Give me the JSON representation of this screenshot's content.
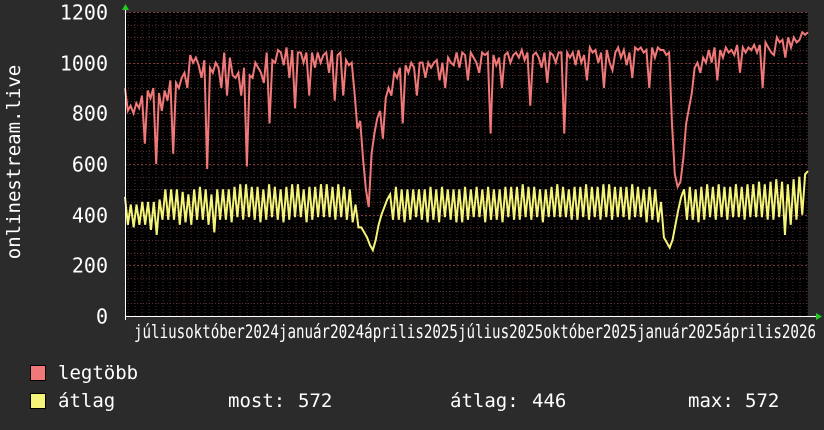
{
  "colors": {
    "background": "#2b2b2b",
    "plot_background": "#000000",
    "grid_major": "#7a3a3a",
    "grid_minor": "#553030",
    "axis": "#ffffff",
    "arrow": "#22cc22",
    "series_max": "#f07878",
    "series_avg": "#f4f47a"
  },
  "legend": {
    "max_label": "legtöbb",
    "avg_label": "átlag",
    "stats": {
      "now_label": "most:",
      "now_value": "572",
      "avg_label": "átlag:",
      "avg_value": "446",
      "max_label": "max:",
      "max_value": "572"
    }
  },
  "chart_data": {
    "type": "line",
    "ylabel": "onlinestream.live",
    "ylim": [
      0,
      1200
    ],
    "yticks": [
      0,
      200,
      400,
      600,
      800,
      1000,
      1200
    ],
    "grid": true,
    "x_labels": [
      "július",
      "október",
      "2024",
      "január",
      "április",
      "2025",
      "július",
      "október",
      "2025",
      "január",
      "április",
      "2026"
    ],
    "x_label_text": "júliusoktóber2024január2024április2025július2025október2025január2025április2026",
    "series": [
      {
        "name": "legtöbb",
        "color": "#f07878",
        "values": [
          900,
          810,
          830,
          800,
          840,
          820,
          870,
          680,
          890,
          860,
          900,
          600,
          880,
          810,
          890,
          850,
          930,
          640,
          920,
          900,
          940,
          960,
          900,
          1030,
          1000,
          1020,
          990,
          940,
          1010,
          580,
          980,
          960,
          1000,
          980,
          900,
          1040,
          870,
          1020,
          950,
          940,
          960,
          870,
          980,
          590,
          950,
          940,
          1000,
          980,
          960,
          920,
          1040,
          760,
          1010,
          1000,
          1050,
          1040,
          990,
          1060,
          940,
          1050,
          820,
          1040,
          1040,
          1000,
          1040,
          870,
          1040,
          980,
          1040,
          1000,
          1030,
          1040,
          960,
          1050,
          850,
          1030,
          1040,
          870,
          1010,
          990,
          1000,
          880,
          740,
          770,
          620,
          500,
          430,
          640,
          720,
          780,
          810,
          700,
          860,
          900,
          870,
          960,
          940,
          980,
          760,
          990,
          960,
          1000,
          980,
          870,
          1000,
          1000,
          940,
          1000,
          980,
          1000,
          1010,
          930,
          1000,
          900,
          1020,
          1000,
          990,
          1040,
          980,
          1040,
          1030,
          930,
          1040,
          1020,
          1000,
          960,
          1040,
          1030,
          1040,
          720,
          1030,
          990,
          1020,
          900,
          1030,
          1040,
          1000,
          1030,
          1040,
          1020,
          1050,
          1010,
          1040,
          830,
          1030,
          1040,
          1020,
          980,
          1040,
          920,
          1040,
          1030,
          1000,
          1040,
          1040,
          720,
          1040,
          1020,
          1040,
          990,
          1050,
          1000,
          1030,
          930,
          1060,
          1040,
          1050,
          1000,
          1040,
          900,
          1050,
          1000,
          970,
          1040,
          1060,
          1020,
          1050,
          990,
          1040,
          940,
          1060,
          1050,
          1060,
          1040,
          1050,
          900,
          1060,
          1020,
          1060,
          1050,
          1050,
          1030,
          1040,
          760,
          560,
          510,
          530,
          620,
          760,
          820,
          880,
          980,
          1000,
          960,
          1020,
          1000,
          1050,
          1000,
          1060,
          930,
          1050,
          1020,
          1060,
          1040,
          1050,
          1030,
          1070,
          960,
          1060,
          1040,
          1060,
          1050,
          1070,
          1040,
          1070,
          900,
          1080,
          1060,
          1040,
          1030,
          1100,
          1080,
          1090,
          1020,
          1100,
          1060,
          1100,
          1080,
          1090,
          1120,
          1110,
          1120
        ]
      },
      {
        "name": "átlag",
        "color": "#f4f47a",
        "values": [
          470,
          360,
          440,
          350,
          440,
          360,
          450,
          360,
          450,
          340,
          450,
          320,
          460,
          380,
          500,
          380,
          500,
          380,
          500,
          360,
          490,
          370,
          480,
          360,
          500,
          380,
          510,
          380,
          500,
          360,
          480,
          330,
          500,
          380,
          500,
          380,
          500,
          370,
          510,
          390,
          520,
          380,
          520,
          390,
          510,
          380,
          510,
          370,
          500,
          380,
          520,
          390,
          510,
          380,
          500,
          370,
          510,
          380,
          520,
          390,
          520,
          390,
          500,
          370,
          510,
          380,
          510,
          390,
          520,
          390,
          520,
          390,
          510,
          380,
          520,
          390,
          510,
          380,
          500,
          370,
          440,
          350,
          350,
          330,
          310,
          280,
          260,
          300,
          360,
          400,
          430,
          460,
          480,
          380,
          510,
          380,
          500,
          370,
          500,
          380,
          500,
          390,
          500,
          380,
          500,
          370,
          510,
          380,
          500,
          370,
          510,
          390,
          500,
          380,
          500,
          370,
          500,
          370,
          510,
          380,
          500,
          390,
          510,
          390,
          500,
          370,
          510,
          380,
          500,
          380,
          500,
          370,
          510,
          390,
          510,
          380,
          510,
          380,
          520,
          390,
          510,
          380,
          510,
          390,
          500,
          370,
          500,
          390,
          510,
          390,
          520,
          390,
          510,
          390,
          500,
          380,
          510,
          380,
          510,
          390,
          520,
          380,
          510,
          390,
          510,
          380,
          520,
          390,
          520,
          380,
          510,
          390,
          510,
          390,
          510,
          380,
          520,
          390,
          510,
          390,
          500,
          370,
          510,
          380,
          500,
          370,
          450,
          310,
          290,
          270,
          300,
          360,
          420,
          470,
          500,
          380,
          510,
          380,
          500,
          370,
          510,
          380,
          520,
          390,
          510,
          380,
          520,
          390,
          510,
          380,
          510,
          390,
          520,
          390,
          510,
          380,
          520,
          390,
          520,
          390,
          530,
          390,
          520,
          380,
          530,
          380,
          540,
          390,
          530,
          320,
          520,
          360,
          540,
          380,
          550,
          400,
          560,
          572
        ]
      }
    ]
  }
}
